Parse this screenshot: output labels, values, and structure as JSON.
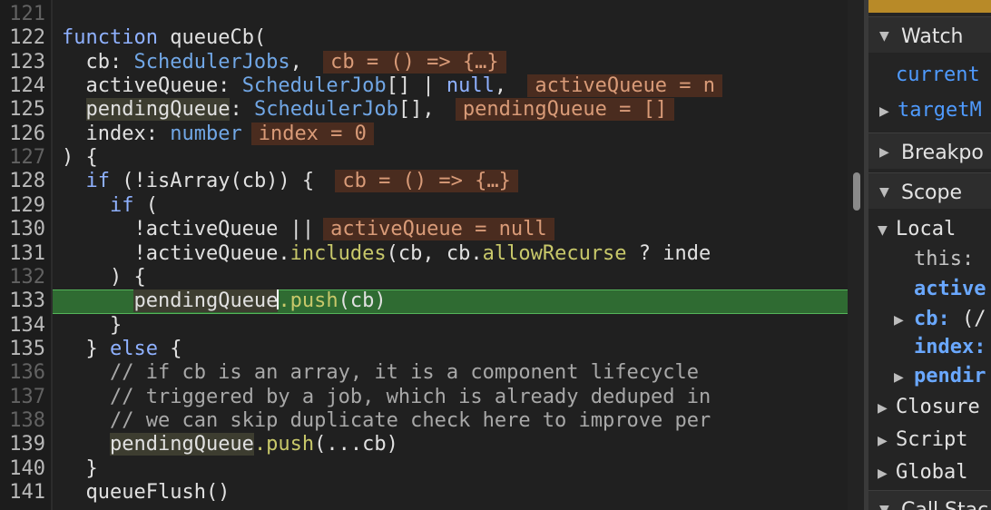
{
  "editor": {
    "lines": [
      {
        "n": "121",
        "dim": true,
        "t": []
      },
      {
        "n": "122",
        "t": [
          [
            "kw",
            "function "
          ],
          [
            "",
            "queueCb("
          ]
        ]
      },
      {
        "n": "123",
        "t": [
          [
            "",
            "  cb: "
          ],
          [
            "type",
            "SchedulerJobs"
          ],
          [
            "",
            ", "
          ],
          [
            "inl",
            "cb = () => {…}"
          ]
        ]
      },
      {
        "n": "124",
        "t": [
          [
            "",
            "  activeQueue: "
          ],
          [
            "type",
            "SchedulerJob"
          ],
          [
            "",
            "[] | "
          ],
          [
            "kw",
            "null"
          ],
          [
            "",
            ", "
          ],
          [
            "inl",
            "activeQueue = n"
          ]
        ]
      },
      {
        "n": "125",
        "t": [
          [
            "",
            "  "
          ],
          [
            "sel",
            "pendingQueue"
          ],
          [
            "",
            ": "
          ],
          [
            "type",
            "SchedulerJob"
          ],
          [
            "",
            "[], "
          ],
          [
            "inl",
            "pendingQueue = []"
          ]
        ]
      },
      {
        "n": "126",
        "t": [
          [
            "",
            "  index: "
          ],
          [
            "type",
            "number"
          ],
          [
            "",
            ""
          ],
          [
            "inl",
            "index = 0"
          ]
        ]
      },
      {
        "n": "127",
        "dim": true,
        "t": [
          [
            "",
            ") {"
          ]
        ]
      },
      {
        "n": "128",
        "t": [
          [
            "",
            "  "
          ],
          [
            "kw",
            "if"
          ],
          [
            "",
            " (!isArray(cb)) { "
          ],
          [
            "inl",
            "cb = () => {…}"
          ]
        ]
      },
      {
        "n": "129",
        "t": [
          [
            "",
            "    "
          ],
          [
            "kw",
            "if"
          ],
          [
            "",
            " ("
          ]
        ]
      },
      {
        "n": "130",
        "t": [
          [
            "",
            "      !activeQueue ||"
          ],
          [
            "inl",
            "activeQueue = null"
          ]
        ]
      },
      {
        "n": "131",
        "t": [
          [
            "",
            "      !activeQueue."
          ],
          [
            "fn",
            "includes"
          ],
          [
            "",
            "(cb, cb."
          ],
          [
            "fn",
            "allowRecurse"
          ],
          [
            "",
            " ? inde"
          ]
        ]
      },
      {
        "n": "132",
        "dim": true,
        "t": [
          [
            "",
            "    ) {"
          ]
        ]
      },
      {
        "n": "133",
        "current": true,
        "t": [
          [
            "",
            "      "
          ],
          [
            "sel",
            "pendingQueue"
          ],
          [
            "caret",
            ""
          ],
          [
            "fn",
            ".push"
          ],
          [
            "",
            "(cb)"
          ]
        ]
      },
      {
        "n": "134",
        "t": [
          [
            "",
            "    }"
          ]
        ]
      },
      {
        "n": "135",
        "t": [
          [
            "",
            "  } "
          ],
          [
            "kw",
            "else"
          ],
          [
            "",
            " {"
          ]
        ]
      },
      {
        "n": "136",
        "dim": true,
        "t": [
          [
            "cm",
            "    // if cb is an array, it is a component lifecycle"
          ]
        ]
      },
      {
        "n": "137",
        "dim": true,
        "t": [
          [
            "cm",
            "    // triggered by a job, which is already deduped in"
          ]
        ]
      },
      {
        "n": "138",
        "dim": true,
        "t": [
          [
            "cm",
            "    // we can skip duplicate check here to improve per"
          ]
        ]
      },
      {
        "n": "139",
        "t": [
          [
            "",
            "    "
          ],
          [
            "sel",
            "pendingQueue"
          ],
          [
            "fn",
            ".push"
          ],
          [
            "",
            "(...cb)"
          ]
        ]
      },
      {
        "n": "140",
        "t": [
          [
            "",
            "  }"
          ]
        ]
      },
      {
        "n": "141",
        "t": [
          [
            "",
            "  queueFlush()"
          ]
        ]
      }
    ]
  },
  "sidebar": {
    "watch_label": "Watch",
    "watch_items": [
      "current",
      "targetM"
    ],
    "breakpoints_label": "Breakpo",
    "scope_label": "Scope",
    "local_label": "Local",
    "local_items": {
      "this_key": "this:",
      "active_key": "active",
      "cb_key": "cb:",
      "cb_val": " (/",
      "index_key": "index:",
      "pending_key": "pendir"
    },
    "closure_label": "Closure",
    "script_label": "Script",
    "global_label": "Global",
    "callstack_label": "Call Stac"
  },
  "colors": {
    "current_line": "#2f6b32",
    "inline_value_bg": "#4a2c1f",
    "inline_value_fg": "#d99b78",
    "keyword": "#8fb1ff",
    "accent_bar": "#b88a28"
  }
}
